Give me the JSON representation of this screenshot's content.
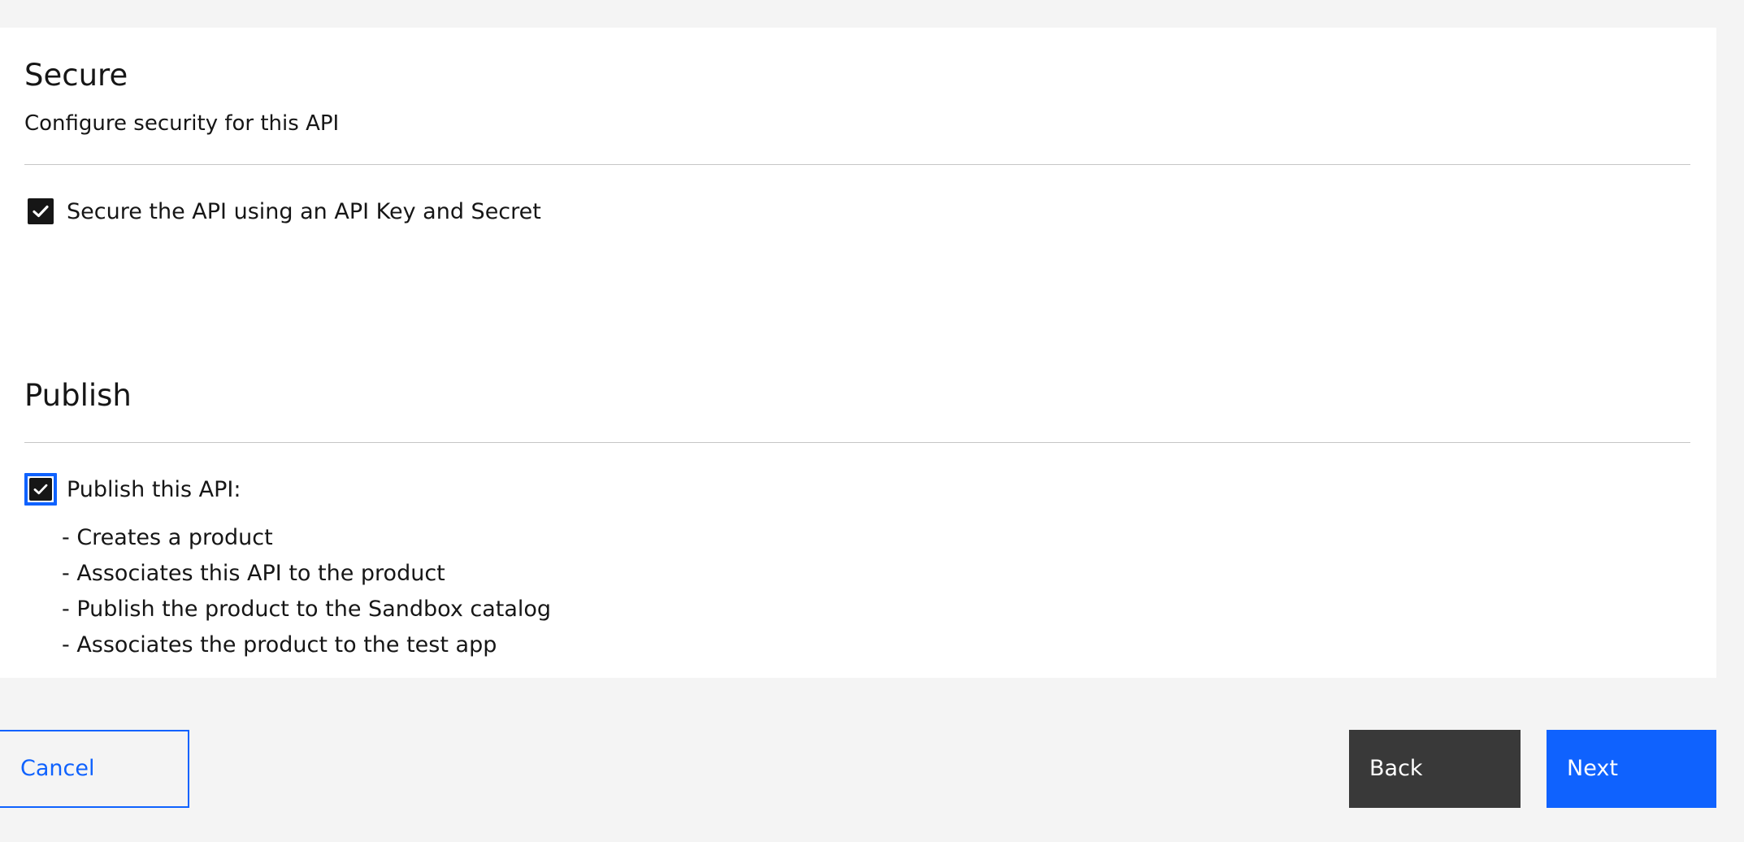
{
  "secure": {
    "title": "Secure",
    "description": "Configure security for this API",
    "checkbox_label": "Secure the API using an API Key and Secret",
    "checked": true
  },
  "publish": {
    "title": "Publish",
    "checkbox_label": "Publish this API:",
    "checked": true,
    "bullets": [
      "- Creates a product",
      "- Associates this API to the product",
      "- Publish the product to the Sandbox catalog",
      "- Associates the product to the test app"
    ]
  },
  "footer": {
    "cancel_label": "Cancel",
    "back_label": "Back",
    "next_label": "Next"
  },
  "colors": {
    "primary": "#0f62fe",
    "secondary_button": "#393939",
    "page_background": "#f4f4f4",
    "panel_background": "#ffffff",
    "text": "#161616"
  },
  "icons": {
    "checkbox": "checkmark-icon"
  }
}
